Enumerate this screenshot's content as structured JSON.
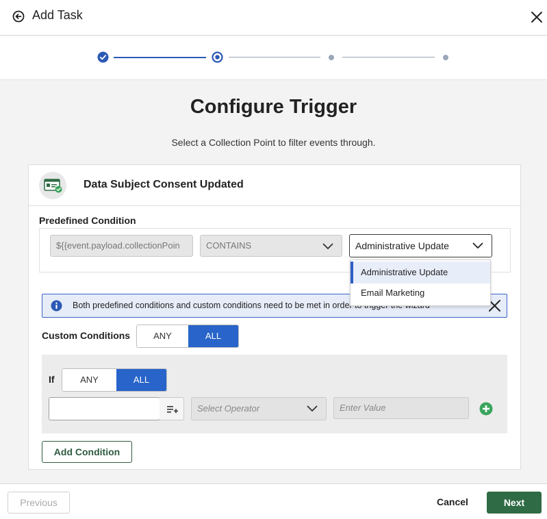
{
  "header": {
    "title": "Add Task"
  },
  "stepper": {
    "steps": [
      "completed",
      "current",
      "upcoming",
      "upcoming"
    ],
    "colors": {
      "active": "#2b59b5",
      "inactive": "#9aa7b8"
    }
  },
  "page": {
    "title": "Configure Trigger",
    "subtitle": "Select a Collection Point to filter events through."
  },
  "event": {
    "name": "Data Subject Consent Updated",
    "icon": "consent-card-icon"
  },
  "predefined": {
    "label": "Predefined Condition",
    "field_value": "${{event.payload.collectionPoin",
    "operator_value": "CONTAINS",
    "selected_value": "Administrative Update",
    "options": [
      "Administrative Update",
      "Email Marketing"
    ]
  },
  "info_banner": {
    "text": "Both predefined conditions and custom conditions need to be met in order to trigger the wizard"
  },
  "custom": {
    "label": "Custom Conditions",
    "any_label": "ANY",
    "all_label": "ALL",
    "selected": "ALL"
  },
  "condition_group": {
    "if_label": "If",
    "any_label": "ANY",
    "all_label": "ALL",
    "selected": "ALL",
    "field_value": "",
    "operator_placeholder": "Select Operator",
    "value_placeholder": "Enter Value"
  },
  "add_condition_label": "Add Condition",
  "footer": {
    "previous_label": "Previous",
    "cancel_label": "Cancel",
    "next_label": "Next"
  },
  "colors": {
    "primary_blue": "#2864c9",
    "brand_green": "#2f6b44",
    "add_icon_green": "#3aa55d"
  }
}
